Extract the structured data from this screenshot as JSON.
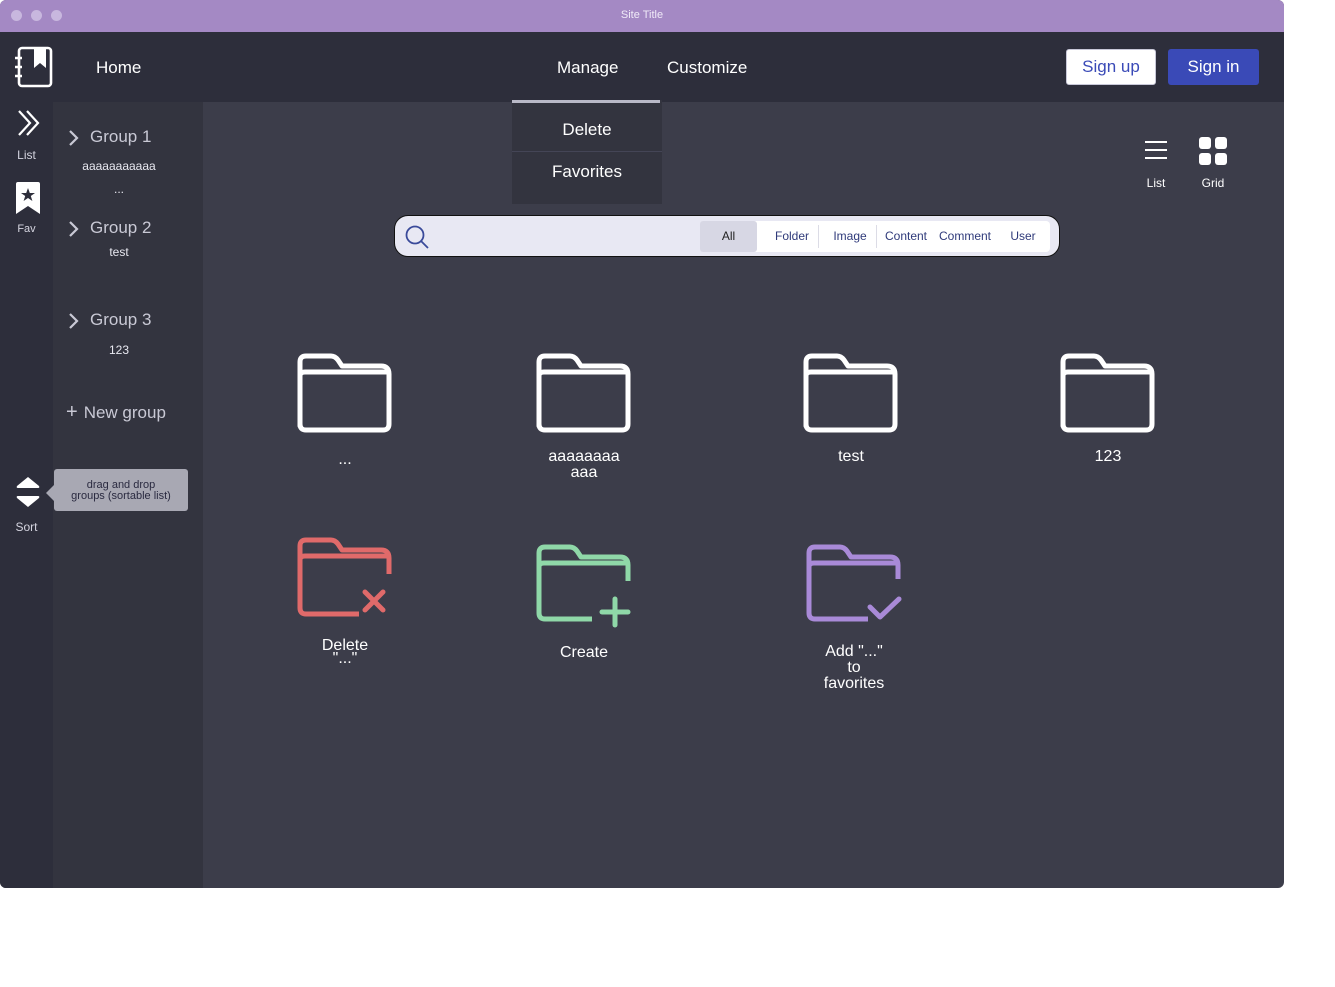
{
  "window": {
    "title": "Site Title"
  },
  "nav": {
    "home": "Home",
    "manage": "Manage",
    "customize": "Customize",
    "sign_up": "Sign up",
    "sign_in": "Sign in"
  },
  "dropdown": {
    "items": [
      "Delete",
      "Favorites"
    ]
  },
  "rail": {
    "list": "List",
    "fav": "Fav",
    "sort": "Sort"
  },
  "groups": [
    {
      "title": "Group 1",
      "sub": [
        "aaaaaaaaaaa",
        "..."
      ]
    },
    {
      "title": "Group 2",
      "sub": [
        "test"
      ]
    },
    {
      "title": "Group 3",
      "sub": [
        "123"
      ]
    }
  ],
  "new_group": "New group",
  "tooltip": [
    "drag and drop",
    "groups (sortable list)"
  ],
  "view": {
    "list": "List",
    "grid": "Grid"
  },
  "search": {
    "placeholder": "",
    "filters": [
      "All",
      "Folder",
      "Image",
      "Content",
      "Comment",
      "User"
    ],
    "active_filter": "All"
  },
  "folders": [
    {
      "lines": [
        "..."
      ]
    },
    {
      "lines": [
        "aaaaaaaa",
        "aaa"
      ]
    },
    {
      "lines": [
        "test"
      ]
    },
    {
      "lines": [
        "123"
      ]
    }
  ],
  "actions": {
    "delete": {
      "lines": [
        "Delete",
        "\"...\""
      ],
      "color": "#e06a6a"
    },
    "create": {
      "lines": [
        "Create"
      ],
      "color": "#8fd8a8"
    },
    "favorite": {
      "lines": [
        "Add \"...\"",
        "to",
        "favorites"
      ],
      "color": "#a98ad8"
    }
  },
  "colors": {
    "accent": "#3a4ab7",
    "titlebar": "#a489c4",
    "background": "#3c3d4a"
  }
}
